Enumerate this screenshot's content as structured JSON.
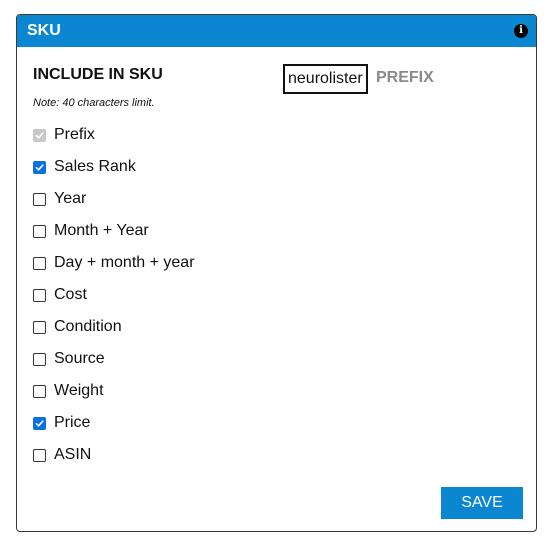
{
  "header": {
    "title": "SKU",
    "info_icon": "info-icon"
  },
  "section": {
    "title": "INCLUDE IN SKU",
    "note": "Note: 40 characters limit."
  },
  "prefix": {
    "value": "neurolister",
    "label": "PREFIX"
  },
  "options": [
    {
      "label": "Prefix",
      "checked": true,
      "disabled": true
    },
    {
      "label": "Sales Rank",
      "checked": true,
      "disabled": false
    },
    {
      "label": "Year",
      "checked": false,
      "disabled": false
    },
    {
      "label": "Month + Year",
      "checked": false,
      "disabled": false
    },
    {
      "label": "Day + month + year",
      "checked": false,
      "disabled": false
    },
    {
      "label": "Cost",
      "checked": false,
      "disabled": false
    },
    {
      "label": "Condition",
      "checked": false,
      "disabled": false
    },
    {
      "label": "Source",
      "checked": false,
      "disabled": false
    },
    {
      "label": "Weight",
      "checked": false,
      "disabled": false
    },
    {
      "label": "Price",
      "checked": true,
      "disabled": false
    },
    {
      "label": "ASIN",
      "checked": false,
      "disabled": false
    }
  ],
  "actions": {
    "save_label": "SAVE"
  },
  "colors": {
    "accent": "#0a87d0",
    "checkbox_checked": "#0a6fe0",
    "prefix_label": "#8a8a8a"
  }
}
